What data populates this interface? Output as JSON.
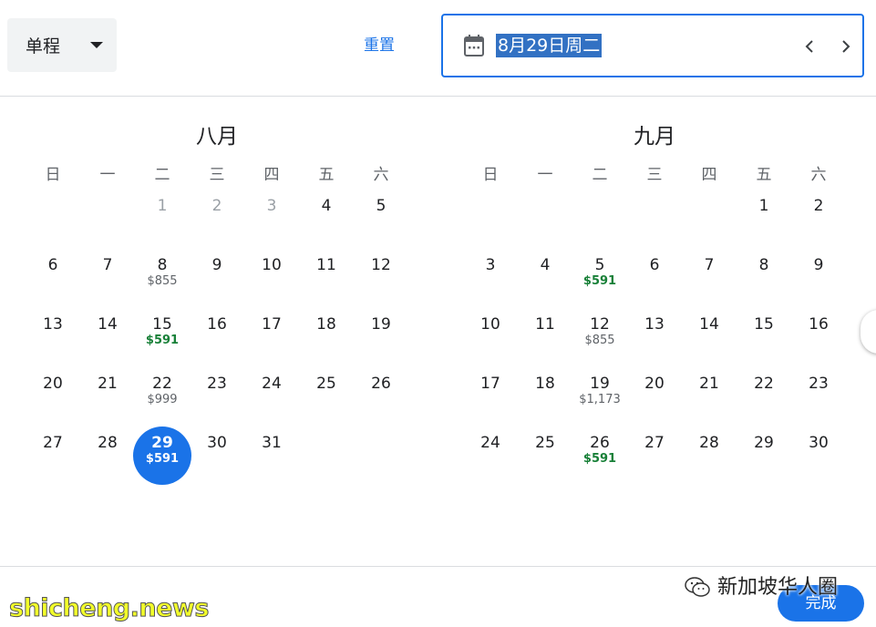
{
  "trip_type": {
    "label": "单程"
  },
  "reset": {
    "label": "重置"
  },
  "date_field": {
    "value": "8月29日周二"
  },
  "weekdays": [
    "日",
    "一",
    "二",
    "三",
    "四",
    "五",
    "六"
  ],
  "months": [
    {
      "name": "八月",
      "days": [
        {
          "day": "1",
          "price": "",
          "state": "disabled"
        },
        {
          "day": "2",
          "price": "",
          "state": "disabled"
        },
        {
          "day": "3",
          "price": "",
          "state": "disabled"
        },
        {
          "day": "4",
          "price": "",
          "state": "normal"
        },
        {
          "day": "5",
          "price": "",
          "state": "normal"
        },
        {
          "day": "6",
          "price": "",
          "state": "normal"
        },
        {
          "day": "7",
          "price": "",
          "state": "normal"
        },
        {
          "day": "8",
          "price": "$855",
          "state": "normal"
        },
        {
          "day": "9",
          "price": "",
          "state": "normal"
        },
        {
          "day": "10",
          "price": "",
          "state": "normal"
        },
        {
          "day": "11",
          "price": "",
          "state": "normal"
        },
        {
          "day": "12",
          "price": "",
          "state": "normal"
        },
        {
          "day": "13",
          "price": "",
          "state": "normal"
        },
        {
          "day": "14",
          "price": "",
          "state": "normal"
        },
        {
          "day": "15",
          "price": "$591",
          "state": "normal",
          "low": true
        },
        {
          "day": "16",
          "price": "",
          "state": "normal"
        },
        {
          "day": "17",
          "price": "",
          "state": "normal"
        },
        {
          "day": "18",
          "price": "",
          "state": "normal"
        },
        {
          "day": "19",
          "price": "",
          "state": "normal"
        },
        {
          "day": "20",
          "price": "",
          "state": "normal"
        },
        {
          "day": "21",
          "price": "",
          "state": "normal"
        },
        {
          "day": "22",
          "price": "$999",
          "state": "normal"
        },
        {
          "day": "23",
          "price": "",
          "state": "normal"
        },
        {
          "day": "24",
          "price": "",
          "state": "normal"
        },
        {
          "day": "25",
          "price": "",
          "state": "normal"
        },
        {
          "day": "26",
          "price": "",
          "state": "normal"
        },
        {
          "day": "27",
          "price": "",
          "state": "normal"
        },
        {
          "day": "28",
          "price": "",
          "state": "normal"
        },
        {
          "day": "29",
          "price": "$591",
          "state": "selected",
          "low": true
        },
        {
          "day": "30",
          "price": "",
          "state": "normal"
        },
        {
          "day": "31",
          "price": "",
          "state": "normal"
        }
      ]
    },
    {
      "name": "九月",
      "days": [
        {
          "day": "1",
          "price": "",
          "state": "normal"
        },
        {
          "day": "2",
          "price": "",
          "state": "normal"
        },
        {
          "day": "3",
          "price": "",
          "state": "normal"
        },
        {
          "day": "4",
          "price": "",
          "state": "normal"
        },
        {
          "day": "5",
          "price": "$591",
          "state": "normal",
          "low": true
        },
        {
          "day": "6",
          "price": "",
          "state": "normal"
        },
        {
          "day": "7",
          "price": "",
          "state": "normal"
        },
        {
          "day": "8",
          "price": "",
          "state": "normal"
        },
        {
          "day": "9",
          "price": "",
          "state": "normal"
        },
        {
          "day": "10",
          "price": "",
          "state": "normal"
        },
        {
          "day": "11",
          "price": "",
          "state": "normal"
        },
        {
          "day": "12",
          "price": "$855",
          "state": "normal"
        },
        {
          "day": "13",
          "price": "",
          "state": "normal"
        },
        {
          "day": "14",
          "price": "",
          "state": "normal"
        },
        {
          "day": "15",
          "price": "",
          "state": "normal"
        },
        {
          "day": "16",
          "price": "",
          "state": "normal"
        },
        {
          "day": "17",
          "price": "",
          "state": "normal"
        },
        {
          "day": "18",
          "price": "",
          "state": "normal"
        },
        {
          "day": "19",
          "price": "$1,173",
          "state": "normal"
        },
        {
          "day": "20",
          "price": "",
          "state": "normal"
        },
        {
          "day": "21",
          "price": "",
          "state": "normal"
        },
        {
          "day": "22",
          "price": "",
          "state": "normal"
        },
        {
          "day": "23",
          "price": "",
          "state": "normal"
        },
        {
          "day": "24",
          "price": "",
          "state": "normal"
        },
        {
          "day": "25",
          "price": "",
          "state": "normal"
        },
        {
          "day": "26",
          "price": "$591",
          "state": "normal",
          "low": true
        },
        {
          "day": "27",
          "price": "",
          "state": "normal"
        },
        {
          "day": "28",
          "price": "",
          "state": "normal"
        },
        {
          "day": "29",
          "price": "",
          "state": "normal"
        },
        {
          "day": "30",
          "price": "",
          "state": "normal"
        }
      ]
    }
  ],
  "done": {
    "label": "完成"
  },
  "watermark": {
    "name": "新加坡华人圈",
    "site": "shicheng.news"
  },
  "icons": {
    "trip_caret": "caret-down-icon",
    "date": "calendar-icon",
    "prev": "chevron-left-icon",
    "next": "chevron-right-icon",
    "watermark": "wechat-icon"
  },
  "colors": {
    "accent": "#1a73e8",
    "low_price": "#188038",
    "price": "#5f6368",
    "disabled": "#9aa0a6",
    "text_selection": "#3271c3",
    "watermark_site": "#f2ff2a"
  }
}
